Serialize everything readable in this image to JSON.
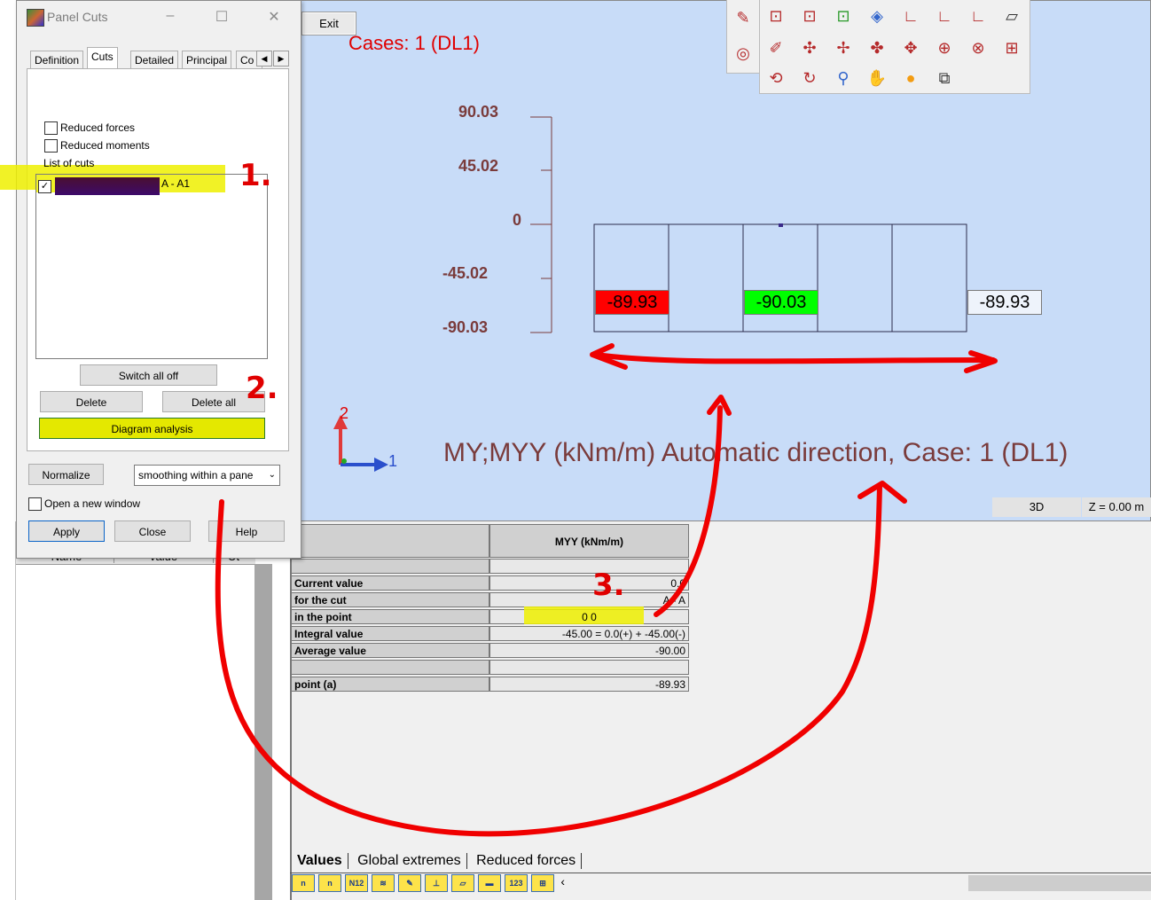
{
  "dialog": {
    "title": "Panel Cuts",
    "tabs": [
      "Definition",
      "Cuts",
      "Detailed",
      "Principal",
      "Co"
    ],
    "reduced_forces": "Reduced forces",
    "reduced_moments": "Reduced moments",
    "list_label": "List of cuts",
    "cut_item": "A - A1",
    "switch_all_off": "Switch all off",
    "delete": "Delete",
    "delete_all": "Delete all",
    "diagram_analysis": "Diagram analysis",
    "normalize": "Normalize",
    "smoothing": "smoothing within a pane",
    "open_new_window": "Open a new window",
    "apply": "Apply",
    "close": "Close",
    "help": "Help"
  },
  "left_panel": {
    "col_name": "Name",
    "col_value": "Value",
    "col_unit": "Ut"
  },
  "view": {
    "exit": "Exit",
    "cases": "Cases: 1 (DL1)",
    "y_ticks": [
      "90.03",
      "45.02",
      "0",
      "-45.02",
      "-90.03"
    ],
    "values": [
      "-89.93",
      "-90.03",
      "-89.93"
    ],
    "title": "MY;MYY (kNm/m) Automatic direction, Case: 1 (DL1)",
    "axis_2": "2",
    "axis_1": "1",
    "btn_3d": "3D",
    "z_label": "Z = 0.00 m",
    "colors": {
      "bg": "#c8dcf8",
      "max": "#ff0000",
      "min": "#00ff00",
      "text": "#7a3b3b"
    }
  },
  "table": {
    "header": "MYY (kNm/m)",
    "rows": [
      {
        "label": "",
        "value": ""
      },
      {
        "label": "Current value",
        "value": "0.0"
      },
      {
        "label": "for the cut",
        "value": "A - A"
      },
      {
        "label": "in the point",
        "value": "0 0"
      },
      {
        "label": "Integral value",
        "value": "-45.00 = 0.0(+) + -45.00(-)"
      },
      {
        "label": "Average value",
        "value": "-90.00"
      },
      {
        "label": "",
        "value": ""
      },
      {
        "label": "point (a)",
        "value": "-89.93"
      }
    ]
  },
  "bottom_tabs": [
    "Values",
    "Global extremes",
    "Reduced forces"
  ],
  "bottom_icons": [
    "n-icon",
    "n-icon",
    "N12",
    "pan-icon",
    "pen-icon",
    "axes-icon",
    "slab-icon",
    "ruler-icon",
    "123",
    "grid-icon"
  ],
  "annotations": [
    "1.",
    "2.",
    "3."
  ]
}
